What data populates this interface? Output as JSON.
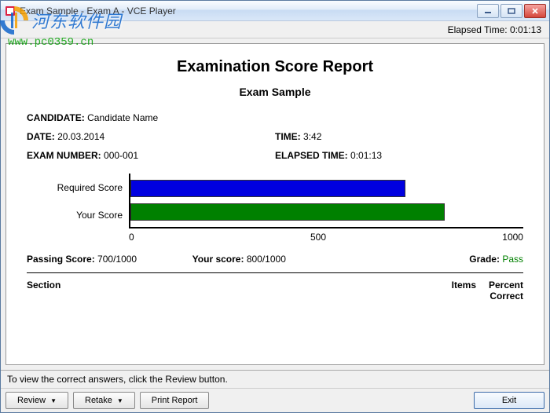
{
  "window": {
    "title": "Exam Sample - Exam A - VCE Player"
  },
  "elapsed_bar": {
    "label": "Elapsed Time:",
    "value": "0:01:13"
  },
  "report": {
    "title": "Examination Score Report",
    "subtitle": "Exam Sample",
    "candidate_label": "CANDIDATE:",
    "candidate_value": "Candidate Name",
    "date_label": "DATE:",
    "date_value": "20.03.2014",
    "time_label": "TIME:",
    "time_value": "3:42",
    "exam_number_label": "EXAM NUMBER:",
    "exam_number_value": "000-001",
    "elapsed_label": "ELAPSED TIME:",
    "elapsed_value": "0:01:13",
    "passing_label": "Passing Score:",
    "passing_value": "700/1000",
    "your_score_label": "Your score:",
    "your_score_value": "800/1000",
    "grade_label": "Grade:",
    "grade_value": "Pass",
    "table": {
      "section": "Section",
      "items": "Items",
      "percent": "Percent Correct"
    }
  },
  "chart_data": {
    "type": "bar",
    "orientation": "horizontal",
    "categories": [
      "Required Score",
      "Your Score"
    ],
    "values": [
      700,
      800
    ],
    "colors": [
      "#0000e0",
      "#008000"
    ],
    "xlim": [
      0,
      1000
    ],
    "xticks": [
      0,
      500,
      1000
    ],
    "title": "",
    "xlabel": "",
    "ylabel": ""
  },
  "hint": "To view the correct answers, click the Review button.",
  "buttons": {
    "review": "Review",
    "retake": "Retake",
    "print": "Print Report",
    "exit": "Exit"
  },
  "watermark": {
    "cn": "河东软件园",
    "url": "www.pc0359.cn"
  }
}
